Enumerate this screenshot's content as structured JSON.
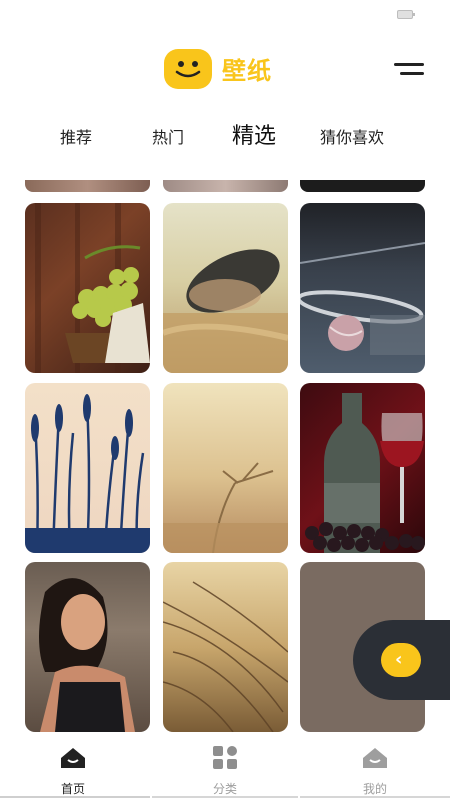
{
  "header": {
    "title": "壁纸"
  },
  "tabs": [
    {
      "label": "推荐"
    },
    {
      "label": "热门"
    },
    {
      "label": "精选"
    },
    {
      "label": "猜你喜欢"
    }
  ],
  "wallpapers": [
    {
      "subject": "grapes"
    },
    {
      "subject": "straw-hat-field"
    },
    {
      "subject": "tennis-racket-ball"
    },
    {
      "subject": "grass-silhouette"
    },
    {
      "subject": "wheat-ears"
    },
    {
      "subject": "wine-bottle-glass"
    },
    {
      "subject": "smiling-woman"
    },
    {
      "subject": "golden-grass"
    },
    {
      "subject": "plain-taupe"
    }
  ],
  "fab": {
    "glyph": "‹"
  },
  "bottom_nav": [
    {
      "label": "首页",
      "icon": "home-icon"
    },
    {
      "label": "分类",
      "icon": "grid-icon"
    },
    {
      "label": "我的",
      "icon": "profile-icon"
    }
  ],
  "colors": {
    "accent": "#f9c51b",
    "dark": "#2b2f36"
  }
}
